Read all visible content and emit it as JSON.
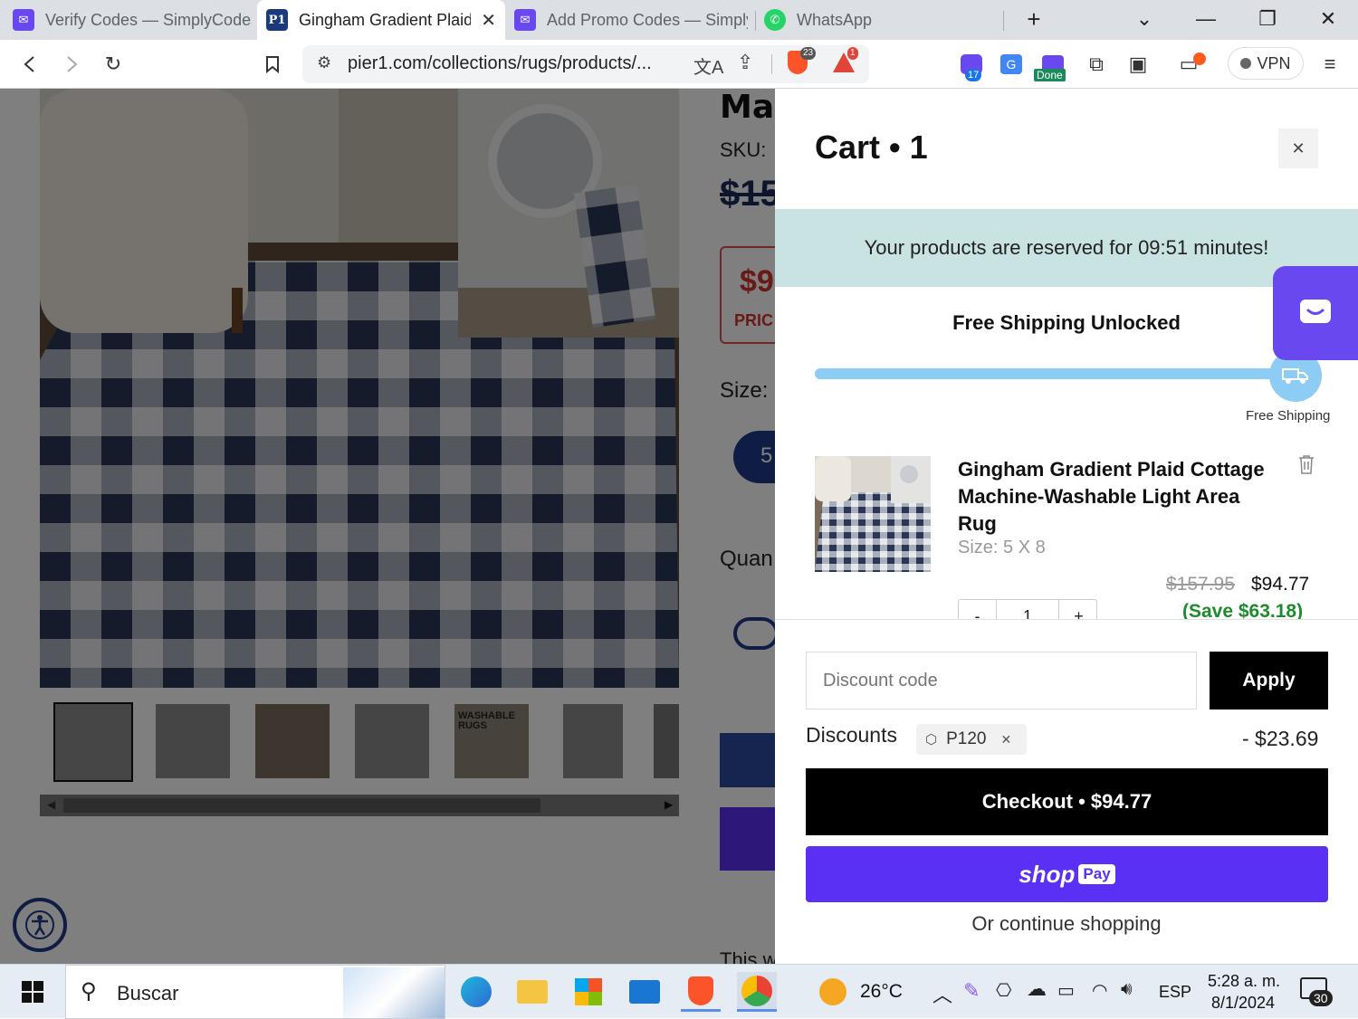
{
  "browser": {
    "tabs": [
      {
        "title": "Verify Codes — SimplyCodes",
        "active": false
      },
      {
        "title": "Gingham Gradient Plaid",
        "active": true
      },
      {
        "title": "Add Promo Codes — Simply",
        "active": false
      },
      {
        "title": "WhatsApp",
        "active": false
      }
    ],
    "url": "pier1.com/collections/rugs/products/...",
    "brave_badge": "23",
    "alert_badge": "1",
    "ext_badge": "17",
    "ext_done": "Done",
    "vpn_label": "VPN"
  },
  "product": {
    "title_partial": "Ma",
    "sku_label": "SKU:",
    "old_price_partial": "$15",
    "price_partial": "$9",
    "price_label_partial": "PRIC",
    "size_label": "Size:",
    "size_option_partial": "5",
    "quantity_label_partial": "Quan",
    "bottom_text_partial": "This w",
    "thumb_label": "WASHABLE RUGS"
  },
  "cart": {
    "title": "Cart • 1",
    "reserved_text": "Your products are reserved for 09:51 minutes!",
    "shipping_heading": "Free Shipping Unlocked",
    "shipping_progress": 1.0,
    "shipping_caption": "Free Shipping",
    "item": {
      "name": "Gingham Gradient Plaid Cottage Machine-Washable Light Area Rug",
      "size": "Size: 5 X 8",
      "compare_price": "$157.95",
      "price": "$94.77",
      "save": "(Save $63.18)",
      "qty": "1",
      "minus": "-",
      "plus": "+"
    },
    "discount_placeholder": "Discount code",
    "apply_label": "Apply",
    "discounts_label": "Discounts",
    "discount_code": "P120",
    "discount_amount": "- $23.69",
    "checkout_label": "Checkout • $94.77",
    "shoppay_brand": "shop",
    "shoppay_pay": "Pay",
    "continue_label": "Or continue shopping"
  },
  "taskbar": {
    "search_label": "Buscar",
    "weather": "26°C",
    "lang": "ESP",
    "time": "5:28 a. m.",
    "date": "8/1/2024",
    "notif_count": "30"
  },
  "colors": {
    "accent_purple": "#6a48f0",
    "progress_blue": "#8dcdf5",
    "reserved_bg": "#c9e3e2",
    "shoppay": "#5a31f4",
    "save_green": "#1e8b2e"
  }
}
